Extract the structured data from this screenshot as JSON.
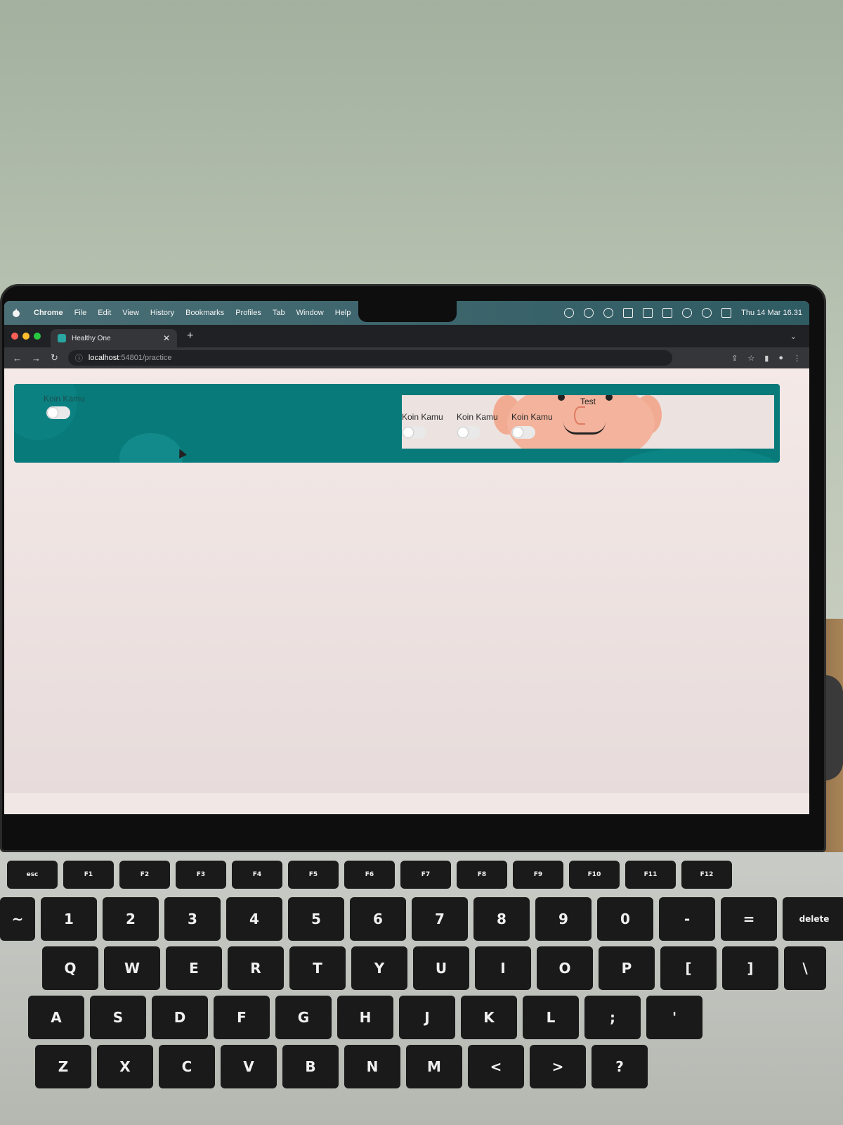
{
  "menubar": {
    "app_name": "Chrome",
    "items": [
      "File",
      "Edit",
      "View",
      "History",
      "Bookmarks",
      "Profiles",
      "Tab",
      "Window",
      "Help"
    ],
    "clock": "Thu 14 Mar  16.31"
  },
  "browser": {
    "tab_title": "Healthy One",
    "url_host": "localhost",
    "url_rest": ":54801/practice"
  },
  "page": {
    "card_label": "Koin Kamu",
    "panel_title": "Test",
    "panel_labels": [
      "Koin Kamu",
      "Koin Kamu",
      "Koin Kamu"
    ]
  },
  "keyboard": {
    "fn_row": [
      "esc",
      "F1",
      "F2",
      "F3",
      "F4",
      "F5",
      "F6",
      "F7",
      "F8",
      "F9",
      "F10",
      "F11",
      "F12"
    ],
    "num_row": [
      "~",
      "1",
      "2",
      "3",
      "4",
      "5",
      "6",
      "7",
      "8",
      "9",
      "0",
      "-",
      "=",
      "delete"
    ],
    "q_row": [
      "Q",
      "W",
      "E",
      "R",
      "T",
      "Y",
      "U",
      "I",
      "O",
      "P",
      "[",
      "]",
      "\\"
    ],
    "a_row": [
      "A",
      "S",
      "D",
      "F",
      "G",
      "H",
      "J",
      "K",
      "L",
      ";",
      "'"
    ],
    "z_row": [
      "Z",
      "X",
      "C",
      "V",
      "B",
      "N",
      "M",
      "<",
      ">",
      "?"
    ]
  }
}
